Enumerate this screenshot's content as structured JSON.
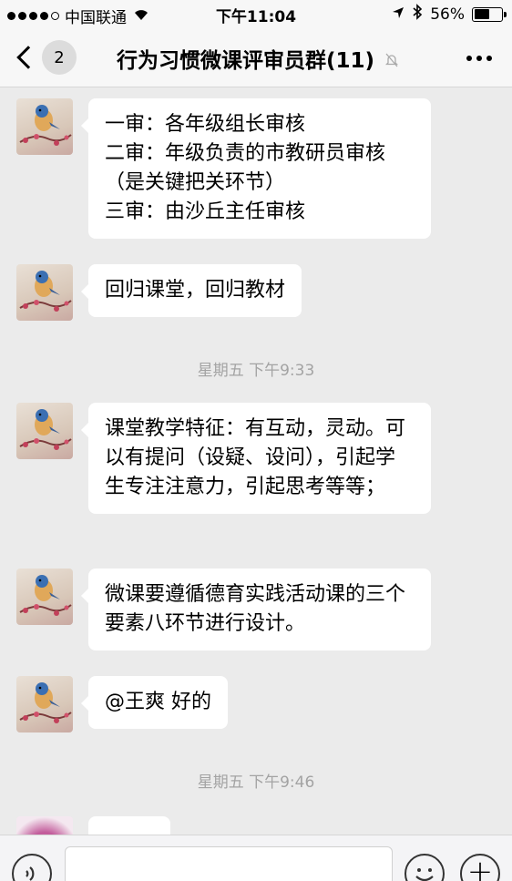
{
  "status_bar": {
    "carrier": "中国联通",
    "time": "下午11:04",
    "battery": "56%",
    "battery_level": 0.56
  },
  "header": {
    "back_badge": "2",
    "title": "行为习惯微课评审员群(11)",
    "icons": {
      "back": "chevron-left-icon",
      "mute": "bell-off-icon",
      "more": "more-horizontal-icon"
    }
  },
  "messages": [
    {
      "type": "text",
      "text": "一审：各年级组长审核\n二审：年级负责的市教研员审核（是关键把关环节）\n三审：由沙丘主任审核"
    },
    {
      "type": "text",
      "text": "回归课堂，回归教材"
    },
    {
      "type": "time",
      "text": "星期五 下午9:33"
    },
    {
      "type": "text",
      "text": "课堂教学特征：有互动，灵动。可以有提问（设疑、设问），引起学生专注注意力，引起思考等等；"
    },
    {
      "type": "text",
      "text": "微课要遵循德育实践活动课的三个要素八环节进行设计。"
    },
    {
      "type": "text",
      "text": "@王爽 好的"
    },
    {
      "type": "time",
      "text": "星期五 下午9:46"
    }
  ],
  "input_bar": {
    "icons": {
      "voice": "voice-icon",
      "emoji": "emoji-icon",
      "plus": "plus-icon"
    }
  }
}
